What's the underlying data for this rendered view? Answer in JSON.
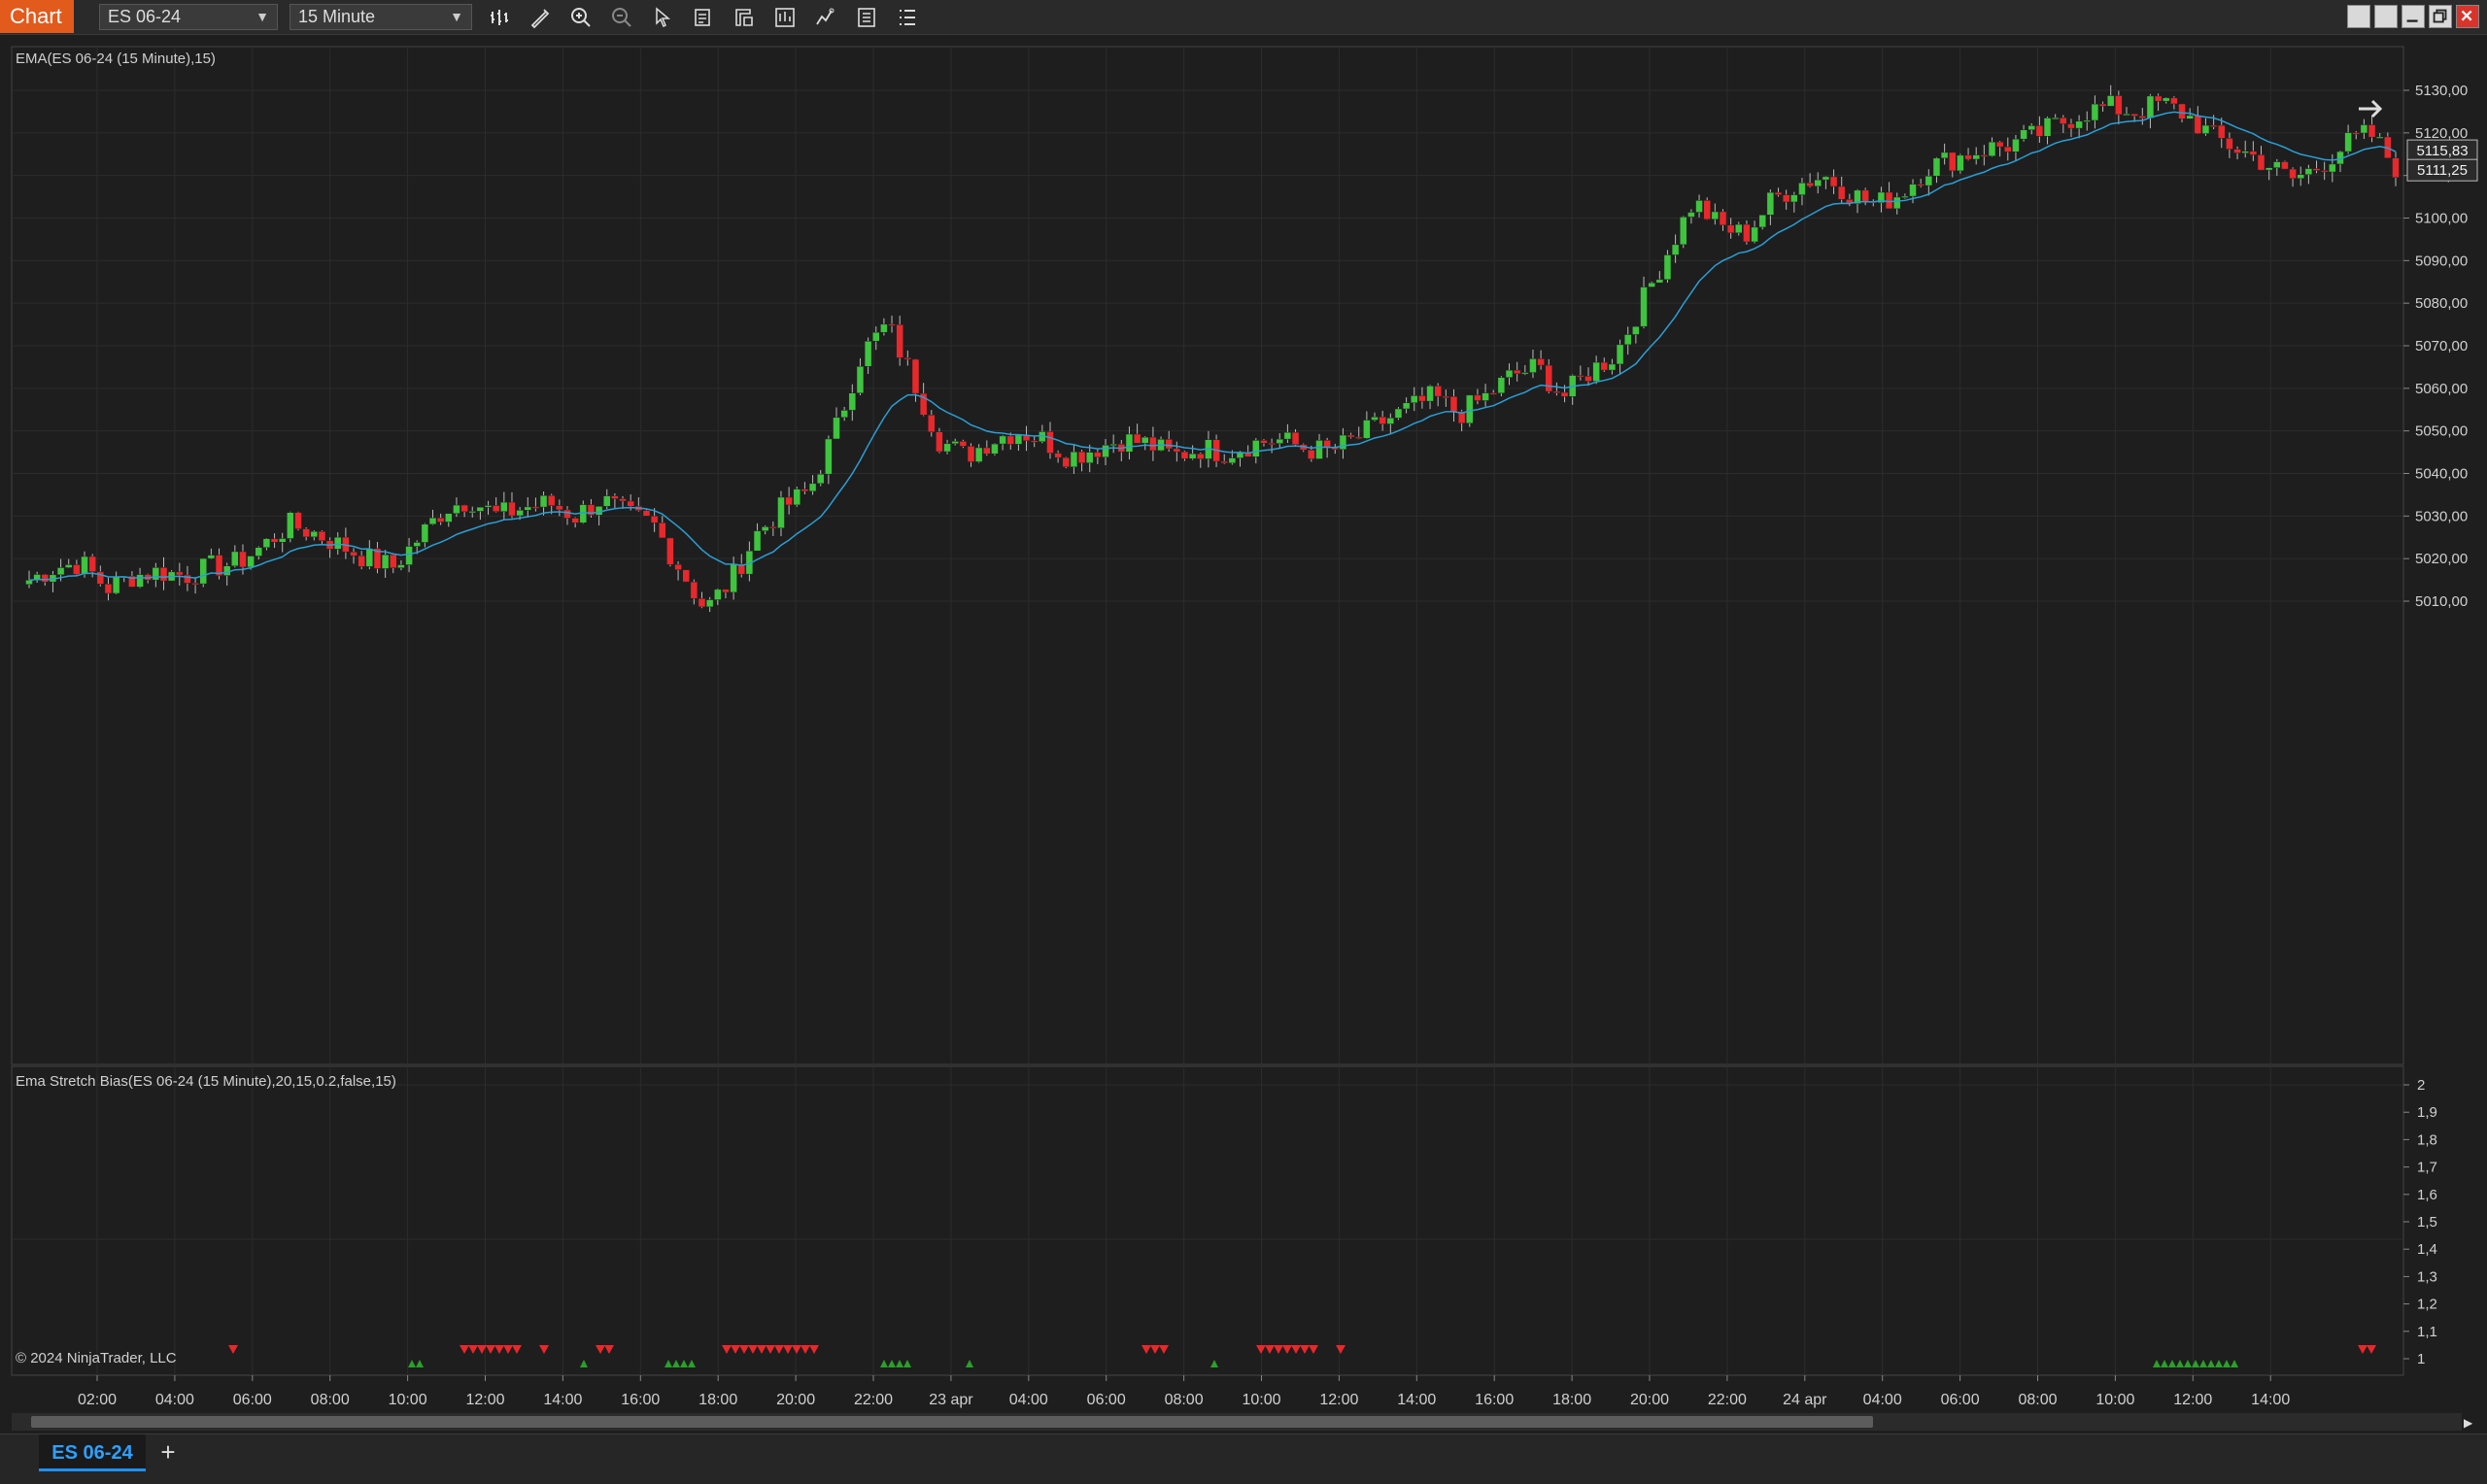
{
  "window": {
    "title": "Chart"
  },
  "toolbar": {
    "instrument": "ES 06-24",
    "interval": "15 Minute",
    "icons": [
      "bar-type-icon",
      "draw-tool-icon",
      "zoom-in-icon",
      "zoom-out-icon",
      "pointer-icon",
      "data-box-icon",
      "properties-icon",
      "templates-icon",
      "strategies-icon",
      "chart-trader-icon",
      "indicators-icon"
    ]
  },
  "price_panel": {
    "indicator_label": "EMA(ES 06-24 (15 Minute),15)",
    "y_ticks": [
      "5130,00",
      "5120,00",
      "5110,00",
      "5100,00",
      "5090,00",
      "5080,00",
      "5070,00",
      "5060,00",
      "5050,00",
      "5040,00",
      "5030,00",
      "5020,00",
      "5010,00"
    ],
    "last_price": "5115,83",
    "ema_value": "5111,25",
    "colors": {
      "up": "#3ec43e",
      "down": "#e8282c",
      "ema": "#2a9fd6",
      "grid": "#2c2c2c",
      "background": "#1e1e1e"
    }
  },
  "indicator_panel": {
    "label": "Ema Stretch Bias(ES 06-24 (15 Minute),20,15,0.2,false,15)",
    "y_ticks": [
      "2",
      "1,9",
      "1,8",
      "1,7",
      "1,6",
      "1,5",
      "1,4",
      "1,3",
      "1,2",
      "1,1",
      "1"
    ],
    "copyright": "© 2024 NinjaTrader, LLC",
    "colors": {
      "up_marker": "#2aa02a",
      "down_marker": "#e8282c"
    }
  },
  "x_axis": {
    "labels": [
      "02:00",
      "04:00",
      "06:00",
      "08:00",
      "10:00",
      "12:00",
      "14:00",
      "16:00",
      "18:00",
      "20:00",
      "22:00",
      "23 apr",
      "04:00",
      "06:00",
      "08:00",
      "10:00",
      "12:00",
      "14:00",
      "16:00",
      "18:00",
      "20:00",
      "22:00",
      "24 apr",
      "04:00",
      "06:00",
      "08:00",
      "10:00",
      "12:00",
      "14:00"
    ]
  },
  "chart_data": {
    "type": "candlestick",
    "instrument": "ES 06-24",
    "interval": "15 Minute",
    "keypoints_close": [
      5015,
      5018,
      5019,
      5013,
      5016,
      5017,
      5016,
      5018,
      5019,
      5023,
      5028,
      5026,
      5023,
      5020,
      5018,
      5025,
      5032,
      5034,
      5030,
      5032,
      5033,
      5030,
      5034,
      5030,
      5028,
      5018,
      5008,
      5015,
      5026,
      5032,
      5036,
      5050,
      5068,
      5075,
      5062,
      5048,
      5044,
      5048,
      5050,
      5048,
      5044,
      5046,
      5048,
      5047,
      5044,
      5046,
      5045,
      5047,
      5048,
      5046,
      5045,
      5048,
      5052,
      5055,
      5058,
      5054,
      5058,
      5063,
      5065,
      5058,
      5064,
      5068,
      5080,
      5092,
      5104,
      5098,
      5096,
      5104,
      5108,
      5110,
      5106,
      5103,
      5106,
      5112,
      5114,
      5116,
      5117,
      5119,
      5122,
      5125,
      5126,
      5125,
      5127,
      5124,
      5119,
      5116,
      5113,
      5109,
      5112,
      5117,
      5120,
      5112
    ],
    "ema_period": 15,
    "last_price": 5115.83,
    "ema_last": 5111.25,
    "indicator_markers_up": [
      {
        "group": 1,
        "count": 2
      },
      {
        "group": 2,
        "count": 1
      },
      {
        "group": 3,
        "count": 4
      },
      {
        "group": 4,
        "count": 4
      },
      {
        "group": 5,
        "count": 1
      },
      {
        "group": 6,
        "count": 1
      },
      {
        "group": 7,
        "count": 11
      }
    ],
    "indicator_markers_down": [
      {
        "group": 1,
        "count": 1
      },
      {
        "group": 2,
        "count": 7
      },
      {
        "group": 3,
        "count": 1
      },
      {
        "group": 4,
        "count": 2
      },
      {
        "group": 5,
        "count": 11
      },
      {
        "group": 6,
        "count": 3
      },
      {
        "group": 7,
        "count": 7
      },
      {
        "group": 8,
        "count": 1
      },
      {
        "group": 9,
        "count": 2
      }
    ]
  },
  "bottom_tabs": {
    "active": "ES 06-24",
    "add_label": "+"
  }
}
